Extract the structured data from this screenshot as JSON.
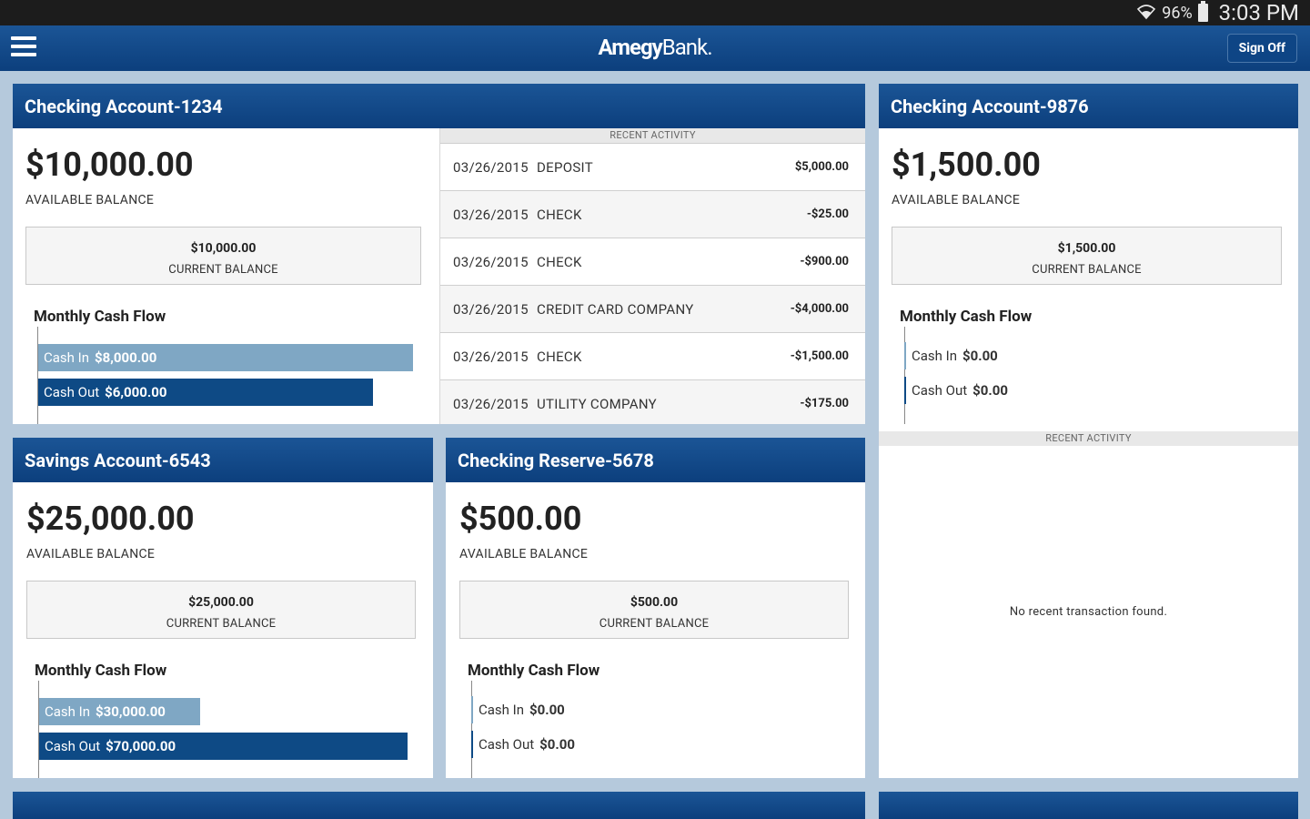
{
  "status": {
    "battery": "96%",
    "time": "3:03 PM"
  },
  "header": {
    "logo_main": "Amegy",
    "logo_bank": "Bank.",
    "signoff": "Sign Off"
  },
  "accounts": [
    {
      "title": "Checking Account-1234",
      "available": "$10,000.00",
      "available_label": "AVAILABLE BALANCE",
      "current": "$10,000.00",
      "current_label": "CURRENT BALANCE",
      "cashflow_title": "Monthly Cash Flow",
      "cash_in_label": "Cash In",
      "cash_in": "$8,000.00",
      "cash_out_label": "Cash Out",
      "cash_out": "$6,000.00"
    },
    {
      "title": "Checking Account-9876",
      "available": "$1,500.00",
      "available_label": "AVAILABLE BALANCE",
      "current": "$1,500.00",
      "current_label": "CURRENT BALANCE",
      "cashflow_title": "Monthly Cash Flow",
      "cash_in_label": "Cash In",
      "cash_in": "$0.00",
      "cash_out_label": "Cash Out",
      "cash_out": "$0.00"
    },
    {
      "title": "Savings Account-6543",
      "available": "$25,000.00",
      "available_label": "AVAILABLE BALANCE",
      "current": "$25,000.00",
      "current_label": "CURRENT BALANCE",
      "cashflow_title": "Monthly Cash Flow",
      "cash_in_label": "Cash In",
      "cash_in": "$30,000.00",
      "cash_out_label": "Cash Out",
      "cash_out": "$70,000.00"
    },
    {
      "title": "Checking Reserve-5678",
      "available": "$500.00",
      "available_label": "AVAILABLE BALANCE",
      "current": "$500.00",
      "current_label": "CURRENT BALANCE",
      "cashflow_title": "Monthly Cash Flow",
      "cash_in_label": "Cash In",
      "cash_in": "$0.00",
      "cash_out_label": "Cash Out",
      "cash_out": "$0.00"
    }
  ],
  "recent_activity": {
    "label": "RECENT ACTIVITY",
    "transactions": [
      {
        "date": "03/26/2015",
        "desc": "DEPOSIT",
        "amount": "$5,000.00"
      },
      {
        "date": "03/26/2015",
        "desc": "CHECK",
        "amount": "-$25.00"
      },
      {
        "date": "03/26/2015",
        "desc": "CHECK",
        "amount": "-$900.00"
      },
      {
        "date": "03/26/2015",
        "desc": "CREDIT CARD COMPANY",
        "amount": "-$4,000.00"
      },
      {
        "date": "03/26/2015",
        "desc": "CHECK",
        "amount": "-$1,500.00"
      },
      {
        "date": "03/26/2015",
        "desc": "UTILITY COMPANY",
        "amount": "-$175.00"
      }
    ]
  },
  "recent_activity_2": {
    "label": "RECENT ACTIVITY",
    "empty": "No recent transaction found."
  }
}
